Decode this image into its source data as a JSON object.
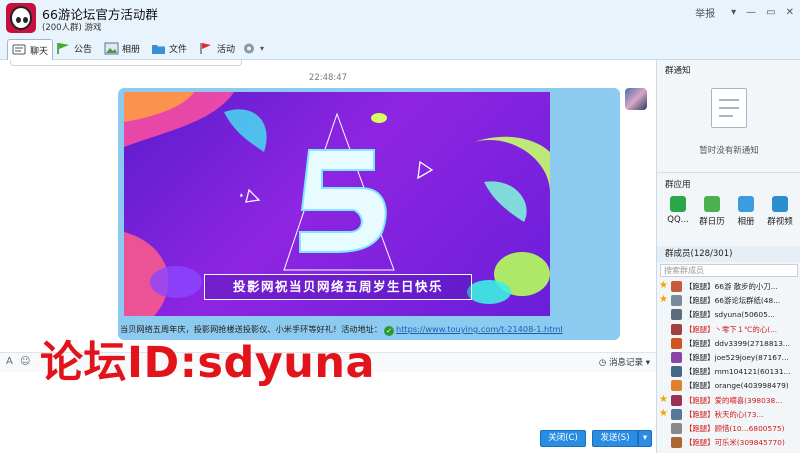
{
  "window": {
    "group_name": "66游论坛官方活动群",
    "member_info": "(200人群) 游戏",
    "report_label": "举报"
  },
  "tabs": [
    {
      "label": "聊天"
    },
    {
      "label": "公告"
    },
    {
      "label": "相册"
    },
    {
      "label": "文件"
    },
    {
      "label": "活动"
    }
  ],
  "chat": {
    "time": "22:48:47",
    "banner_caption": "投影网祝当贝网络五周岁生日快乐",
    "message_text": "当贝网络五周年庆，投影网抢楼送投影仪、小米手环等好礼！活动地址：",
    "message_link": "https://www.touying.com/t-21408-1.html",
    "history_label": "消息记录"
  },
  "watermark": "论坛ID:sdyuna",
  "buttons": {
    "close": "关闭(C)",
    "send": "发送(S)"
  },
  "sidebar": {
    "notice_title": "群通知",
    "notice_empty": "暂时没有新通知",
    "apps_title": "群应用",
    "apps": [
      {
        "label": "QQ..."
      },
      {
        "label": "群日历"
      },
      {
        "label": "相册"
      },
      {
        "label": "群视频"
      }
    ],
    "members_title": "群成员(128/301)",
    "search_placeholder": "搜索群成员",
    "members": [
      {
        "name": "【跑腿】66游 散步的小刀...",
        "crown": true,
        "red": false,
        "color": "#c75a3a"
      },
      {
        "name": "【跑腿】66游论坛群纸(48...",
        "crown": true,
        "red": false,
        "color": "#7a8a99"
      },
      {
        "name": "【跑腿】sdyuna(50605...",
        "crown": false,
        "red": false,
        "color": "#5b6c7d"
      },
      {
        "name": "【跑腿】丶零下１℃的心(...",
        "crown": false,
        "red": true,
        "color": "#a04040"
      },
      {
        "name": "【跑腿】ddv3399(2718813...",
        "crown": false,
        "red": false,
        "color": "#cc5522"
      },
      {
        "name": "【跑腿】joe529joey(87167...",
        "crown": false,
        "red": false,
        "color": "#8844aa"
      },
      {
        "name": "【跑腿】mm104121(60131...",
        "crown": false,
        "red": false,
        "color": "#446688"
      },
      {
        "name": "【跑腿】orange(403998479)",
        "crown": false,
        "red": false,
        "color": "#e08030"
      },
      {
        "name": "【跑腿】爱的嘀喜(398038...",
        "crown": true,
        "red": true,
        "color": "#993355"
      },
      {
        "name": "【跑腿】秋天的心(73...",
        "crown": true,
        "red": true,
        "color": "#557799"
      },
      {
        "name": "【跑腿】顾惜(10...6800575)",
        "crown": false,
        "red": true,
        "color": "#888"
      },
      {
        "name": "【跑腿】可乐米(309845770)",
        "crown": false,
        "red": true,
        "color": "#aa6633"
      }
    ]
  }
}
